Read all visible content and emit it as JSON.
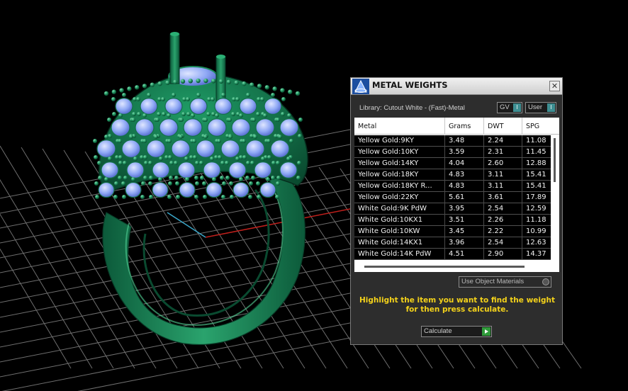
{
  "panel": {
    "title": "METAL WEIGHTS",
    "close_glyph": "✕",
    "library": "Library: Cutout White - (Fast)-Metal",
    "gv_label": "GV",
    "user_label": "User",
    "toggle_glyph": "I",
    "use_object_materials": "Use Object Materials",
    "instructions": "Highlight the item you want to find the weight for then press calculate.",
    "calculate": "Calculate",
    "icons": {
      "app": "rhino-app-icon",
      "close": "close-icon",
      "calculate": "play-icon"
    }
  },
  "table": {
    "columns": [
      "Metal",
      "Grams",
      "DWT",
      "SPG"
    ],
    "rows": [
      [
        "Yellow Gold:9KY",
        "3.48",
        "2.24",
        "11.08"
      ],
      [
        "Yellow Gold:10KY",
        "3.59",
        "2.31",
        "11.45"
      ],
      [
        "Yellow Gold:14KY",
        "4.04",
        "2.60",
        "12.88"
      ],
      [
        "Yellow Gold:18KY",
        "4.83",
        "3.11",
        "15.41"
      ],
      [
        "Yellow Gold:18KY R...",
        "4.83",
        "3.11",
        "15.41"
      ],
      [
        "Yellow Gold:22KY",
        "5.61",
        "3.61",
        "17.89"
      ],
      [
        "White Gold:9K PdW",
        "3.95",
        "2.54",
        "12.59"
      ],
      [
        "White Gold:10KX1",
        "3.51",
        "2.26",
        "11.18"
      ],
      [
        "White Gold:10KW",
        "3.45",
        "2.22",
        "10.99"
      ],
      [
        "White Gold:14KX1",
        "3.96",
        "2.54",
        "12.63"
      ],
      [
        "White Gold:14K PdW",
        "4.51",
        "2.90",
        "14.37"
      ]
    ]
  },
  "colors": {
    "ring_metal": "#1b8a5a",
    "gem": "#8fa8f5",
    "grid": "#6e6e6e",
    "x_axis": "#c0201c",
    "y_axis": "#3aa6c8",
    "instructions_text": "#f4d21a"
  }
}
